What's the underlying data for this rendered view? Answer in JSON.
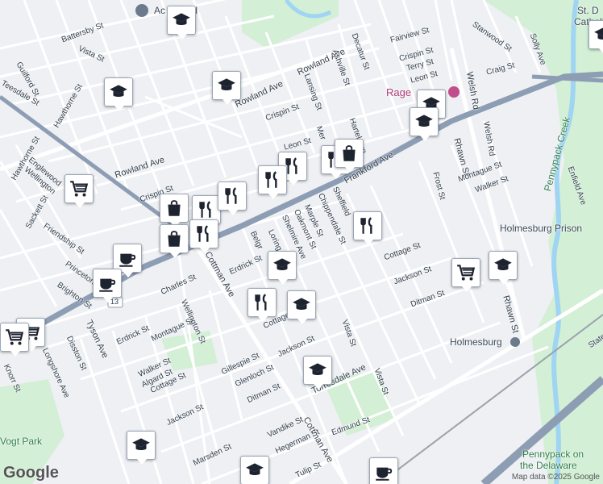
{
  "colors": {
    "background": "#eef0f3",
    "street": "#ffffff",
    "highway": "#8d9db3",
    "rail": "#9aa2ad",
    "park": "#cdeccf",
    "water": "#9fd4f3",
    "icon": "#1e2330"
  },
  "streets": {
    "battersby": "Battersby St",
    "vista_nw": "Vista St",
    "guilford": "Guilford St",
    "teesdale": "Teesdale St",
    "hawthorne1": "Hawthorne St",
    "hawthorne2": "Hawthorne St",
    "rowland1": "Rowland Ave",
    "rowland2": "Rowland Ave",
    "rowland3": "Rowland Ave",
    "englewood": "Englewood",
    "wellington1": "Wellington",
    "sackett": "Sackett St",
    "crispin1": "Crispin St",
    "crispin2": "Crispin St",
    "crispin3": "Crispin St",
    "friendship": "Friendship St",
    "princeton": "Princeton",
    "brighton": "Brighton St",
    "lansing": "Lansing St",
    "ashville": "Ashville St",
    "decatur": "Decatur St",
    "fairview": "Fairview St",
    "terry": "Terry St",
    "leon1": "Leon St",
    "leon2": "Leon St",
    "hartel": "Hartel Ave",
    "frankford": "Frankford Ave",
    "welsh1": "Welsh Rd",
    "welsh2": "Welsh Rd",
    "rhawn1": "Rhawn St",
    "rhawn2": "Rhawn St",
    "frost": "Frost St",
    "montague1": "Montague St",
    "montague2": "Montague St",
    "walker1": "Walker St",
    "walker2": "Walker St",
    "cottage1": "Cottage St",
    "cottage2": "Cottage St",
    "cottage3": "Cottage St",
    "jackson1": "Jackson St",
    "jackson2": "Jackson St",
    "jackson3": "Jackson St",
    "ditman1": "Ditman St",
    "ditman2": "Ditman St",
    "vista1": "Vista St",
    "vista2": "Vista St",
    "torresdale": "Torresdale Ave",
    "edmund": "Edmund St",
    "cottman1": "Cottman Ave",
    "cottman2": "Cottman Ave",
    "erdrick1": "Erdrick St",
    "erdrick2": "Erdrick St",
    "charles": "Charles St",
    "wellington2": "Wellington St",
    "tyson": "Tyson Ave",
    "disston": "Disston St",
    "longshore": "Longshore Ave",
    "knorr": "Knorr St",
    "algard": "Algard St",
    "gillespie": "Gillespie St",
    "glenloch": "Glenloch St",
    "marsden": "Marsden St",
    "vandike": "Vandike St",
    "hegerman": "Hegerman St",
    "tulip": "Tulip St",
    "loring": "Loring St",
    "sheffield": "Sheffield",
    "chippendale": "Chippendale St",
    "marple": "Marple St",
    "oakmont": "Oakmont St",
    "shelmire": "Shelmire Ave",
    "stanwood": "Stanwood St",
    "solly": "Solly Ave",
    "craig": "Craig St",
    "enfield": "Enfield Ave",
    "state": "State R",
    "crispin4": "Crispin St",
    "mer": "Mer",
    "belg": "Belgr"
  },
  "places": {
    "school": "Ac  School",
    "catholic": "St. D",
    "catholic2": "Catholic C",
    "rage": "Rage",
    "pennypack_creek": "Pennypack Creek",
    "prison": "Holmesburg Prison",
    "holmesburg": "Holmesburg",
    "vogt": "Vogt Park",
    "pennypack_del1": "Pennypack on",
    "pennypack_del2": "the Delaware",
    "route": "13"
  },
  "footer": {
    "google": "Google",
    "attribution": "Map data ©2025 Google"
  },
  "markers": [
    {
      "id": "school-1",
      "icon": "school"
    },
    {
      "id": "school-2",
      "icon": "school"
    },
    {
      "id": "school-3",
      "icon": "school"
    },
    {
      "id": "school-4",
      "icon": "school"
    },
    {
      "id": "school-5",
      "icon": "school"
    },
    {
      "id": "school-6",
      "icon": "school"
    },
    {
      "id": "school-7",
      "icon": "school"
    },
    {
      "id": "school-8",
      "icon": "school"
    },
    {
      "id": "school-9",
      "icon": "school"
    },
    {
      "id": "school-10",
      "icon": "school"
    },
    {
      "id": "school-11",
      "icon": "school"
    },
    {
      "id": "school-12",
      "icon": "school"
    },
    {
      "id": "shop-1",
      "icon": "cart"
    },
    {
      "id": "shop-2",
      "icon": "cart"
    },
    {
      "id": "shop-3",
      "icon": "cart"
    },
    {
      "id": "shop-4",
      "icon": "cart"
    },
    {
      "id": "food-1",
      "icon": "food"
    },
    {
      "id": "food-2",
      "icon": "food"
    },
    {
      "id": "food-3",
      "icon": "food"
    },
    {
      "id": "food-4",
      "icon": "food"
    },
    {
      "id": "food-5",
      "icon": "food"
    },
    {
      "id": "food-6",
      "icon": "food"
    },
    {
      "id": "food-7",
      "icon": "food"
    },
    {
      "id": "food-8",
      "icon": "food"
    },
    {
      "id": "bag-1",
      "icon": "bag"
    },
    {
      "id": "bag-2",
      "icon": "bag"
    },
    {
      "id": "bag-3",
      "icon": "bag"
    },
    {
      "id": "cafe-1",
      "icon": "cafe"
    },
    {
      "id": "cafe-2",
      "icon": "cafe"
    },
    {
      "id": "cafe-3",
      "icon": "cafe"
    }
  ]
}
